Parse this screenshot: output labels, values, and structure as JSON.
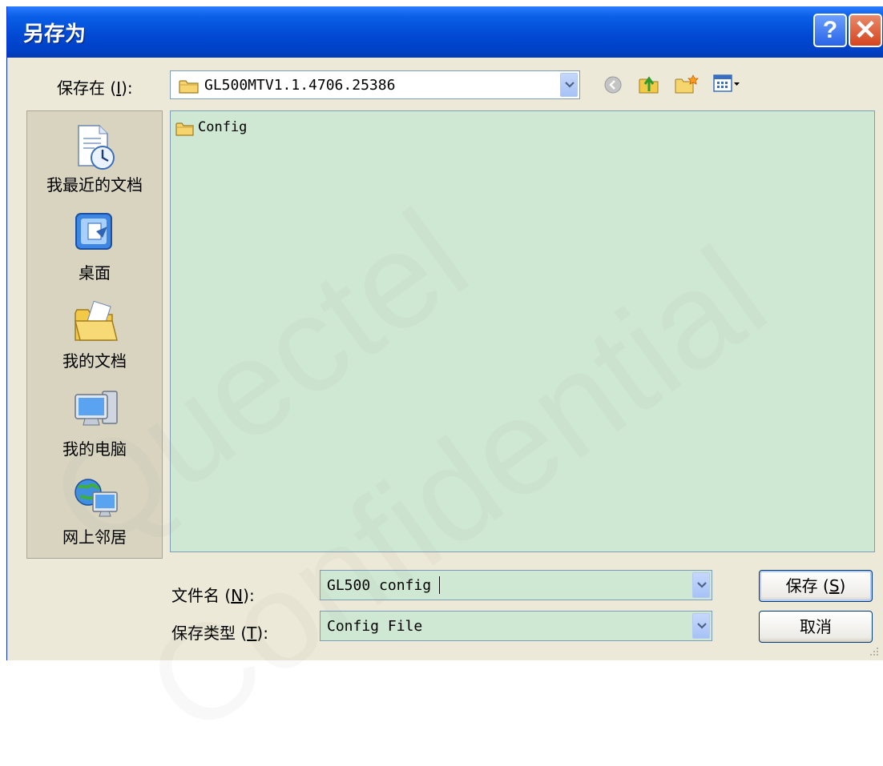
{
  "window": {
    "title": "另存为",
    "help_label": "?",
    "close_label": "✕"
  },
  "location": {
    "label": "保存在 (",
    "hotkey": "I",
    "label_end": "):",
    "current_folder": "GL500MTV1.1.4706.25386"
  },
  "toolbar": {
    "icons": [
      "back-icon",
      "up-folder-icon",
      "new-folder-icon",
      "view-menu-icon"
    ]
  },
  "places": [
    {
      "label": "我最近的文档",
      "icon": "recent-documents-icon"
    },
    {
      "label": "桌面",
      "icon": "desktop-icon"
    },
    {
      "label": "我的文档",
      "icon": "my-documents-icon"
    },
    {
      "label": "我的电脑",
      "icon": "my-computer-icon"
    },
    {
      "label": "网上邻居",
      "icon": "network-places-icon"
    }
  ],
  "files": [
    {
      "name": "Config",
      "icon": "folder-icon"
    }
  ],
  "filename": {
    "label": "文件名 (",
    "hotkey": "N",
    "label_end": "):",
    "value": "GL500 config"
  },
  "filetype": {
    "label": "保存类型 (",
    "hotkey": "T",
    "label_end": "):",
    "value": "Config File"
  },
  "buttons": {
    "save_label": "保存 (",
    "save_hotkey": "S",
    "save_end": ")",
    "cancel_label": "取消"
  },
  "watermark": {
    "line1": "Quectel",
    "line2": "Confidential"
  },
  "colors": {
    "titlebar": "#0148d2",
    "dialog_background": "#ece9d8",
    "file_list_background": "#cfe8d3"
  }
}
